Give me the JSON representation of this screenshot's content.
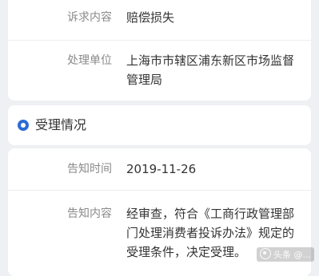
{
  "complaint": {
    "rows": [
      {
        "label": "诉求内容",
        "value": "赔偿损失"
      },
      {
        "label": "处理单位",
        "value_lines": [
          "上海市市辖区浦东新区市场监督",
          "管理局"
        ]
      }
    ]
  },
  "section": {
    "icon": "circle-dot-icon",
    "title": "受理情况"
  },
  "acceptance": {
    "rows": [
      {
        "label": "告知时间",
        "value": "2019-11-26"
      },
      {
        "label": "告知内容",
        "value_lines": [
          "经审查，符合《工商行政管理部",
          "门处理消费者投诉办法》规定的",
          "受理条件，决定受理。"
        ]
      }
    ]
  },
  "watermark": {
    "text": "头条 @..."
  },
  "colors": {
    "accent": "#2d6bd6",
    "label": "#8a8a8a",
    "text": "#333333",
    "background": "#eef0f3"
  }
}
